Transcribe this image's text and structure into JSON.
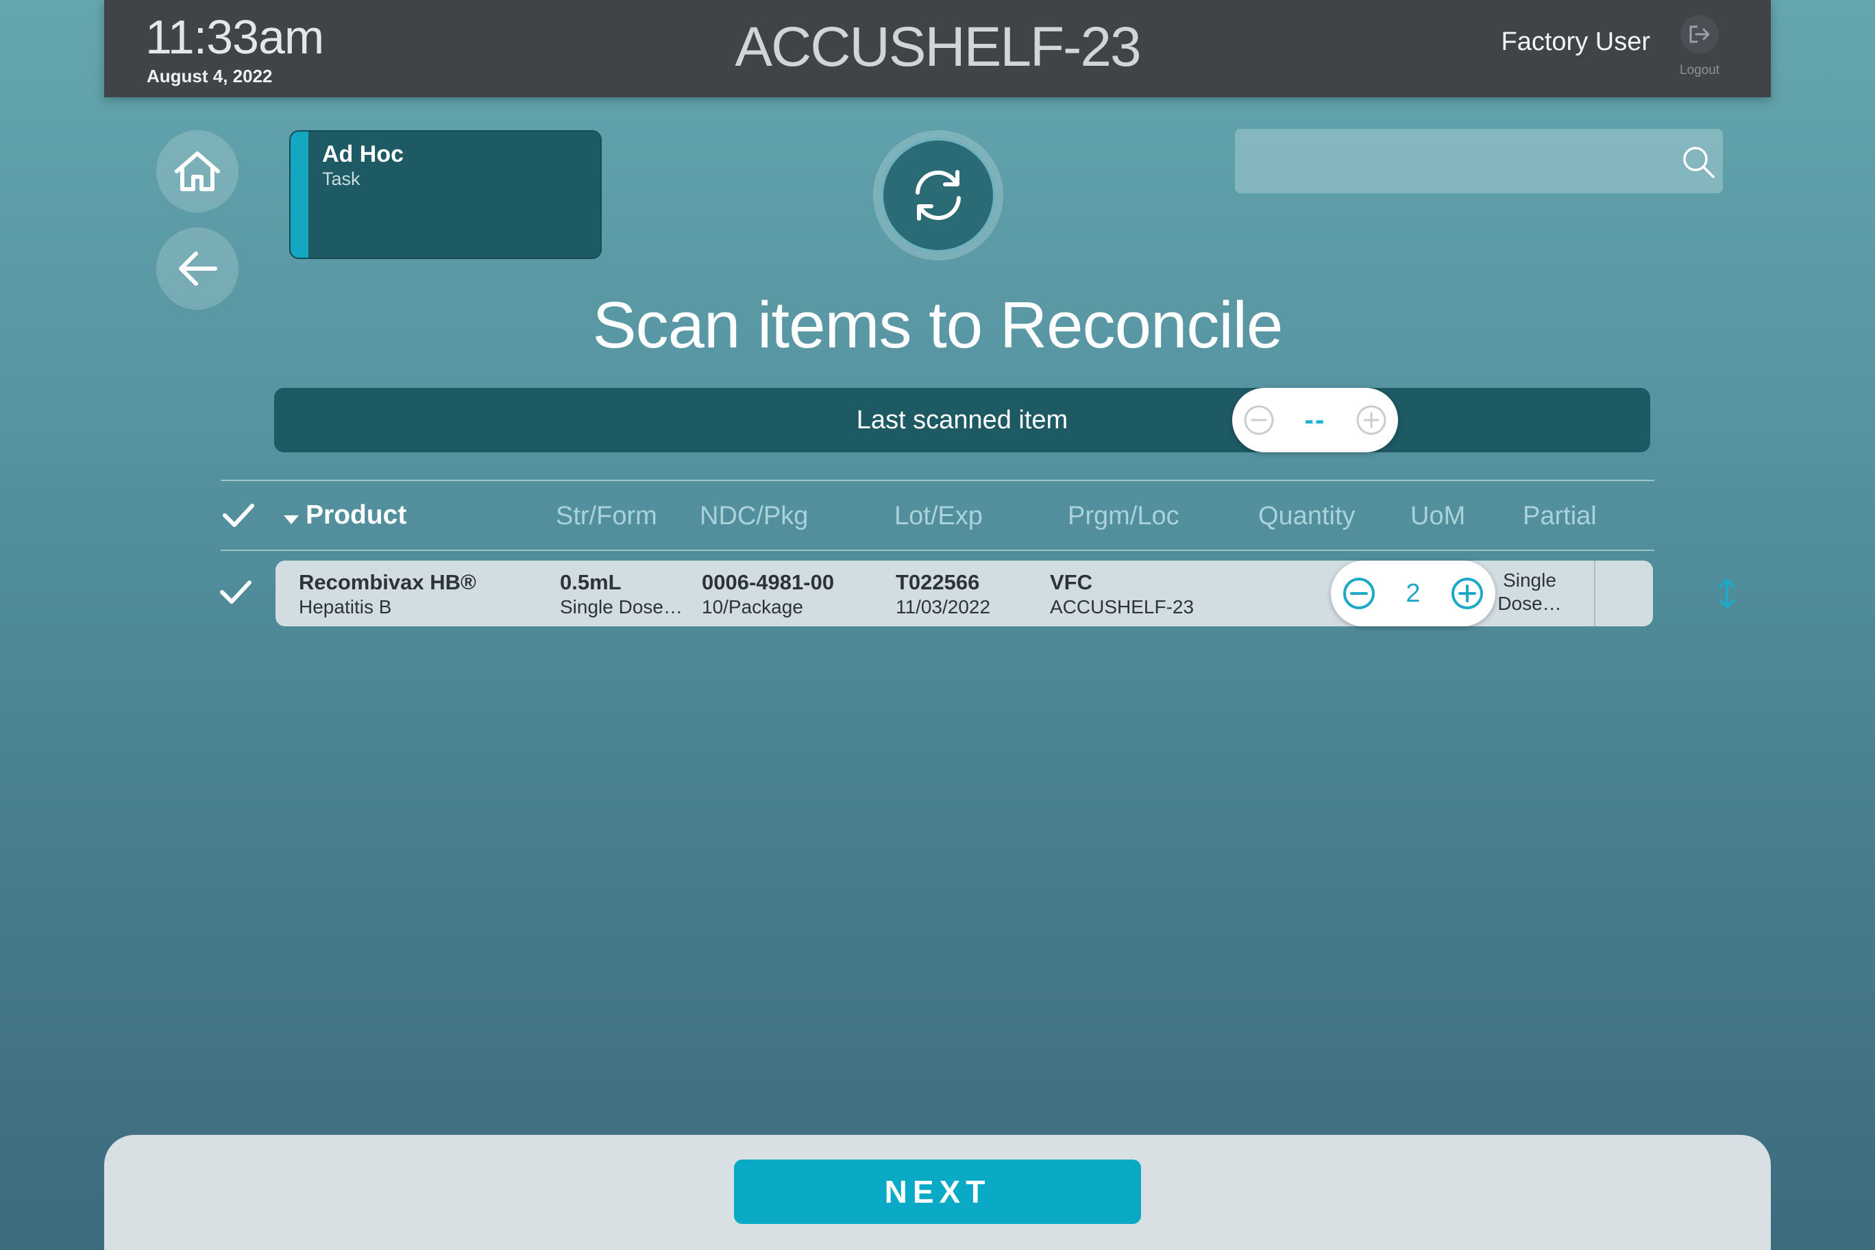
{
  "header": {
    "time": "11:33am",
    "date": "August 4, 2022",
    "device_name": "ACCUSHELF-23",
    "user": "Factory User",
    "logout_label": "Logout"
  },
  "task": {
    "title": "Ad Hoc",
    "subtitle": "Task"
  },
  "search": {
    "placeholder": "",
    "value": ""
  },
  "page_title": "Scan items to Reconcile",
  "last_scanned": {
    "label": "Last scanned item",
    "value": "--"
  },
  "table": {
    "columns": [
      "Product",
      "Str/Form",
      "NDC/Pkg",
      "Lot/Exp",
      "Prgm/Loc",
      "Quantity",
      "UoM",
      "Partial"
    ],
    "rows": [
      {
        "product_name": "Recombivax HB®",
        "product_desc": "Hepatitis B",
        "strength": "0.5mL",
        "form": "Single Dose…",
        "ndc": "0006-4981-00",
        "pkg": "10/Package",
        "lot": "T022566",
        "exp": "11/03/2022",
        "program": "VFC",
        "location": "ACCUSHELF-23",
        "quantity": "2",
        "uom_line1": "Single",
        "uom_line2": "Dose…"
      }
    ]
  },
  "footer": {
    "next_label": "NEXT"
  },
  "colors": {
    "accent": "#0aa9c6",
    "header_bg": "#404347",
    "card_bg": "#1e5a64",
    "row_bg": "#d2dde2"
  }
}
